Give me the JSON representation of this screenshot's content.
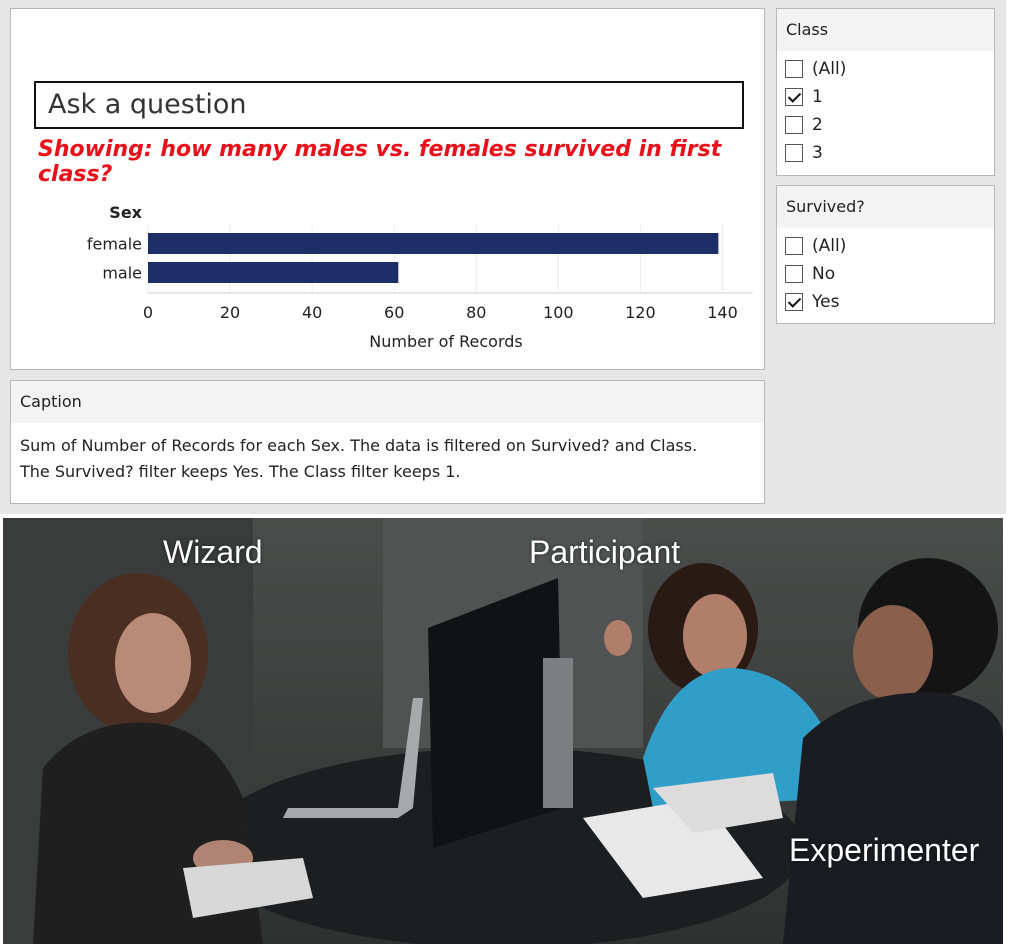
{
  "ask_placeholder": "Ask a question",
  "showing_text": "Showing: how many males vs. females survived in first class?",
  "chart_data": {
    "type": "bar",
    "orientation": "horizontal",
    "dimension_label": "Sex",
    "categories": [
      "female",
      "male"
    ],
    "values": [
      139,
      61
    ],
    "xlabel": "Number of Records",
    "xlim": [
      0,
      145
    ],
    "ticks": [
      "0",
      "20",
      "40",
      "60",
      "80",
      "100",
      "120",
      "140"
    ],
    "bar_color": "#1c2f66"
  },
  "caption": {
    "header": "Caption",
    "line1": "Sum of Number of Records for each Sex. The data is filtered on Survived? and Class.",
    "line2": "The Survived? filter keeps Yes. The Class filter keeps 1."
  },
  "filters": {
    "class": {
      "title": "Class",
      "options": [
        {
          "label": "(All)",
          "checked": false
        },
        {
          "label": "1",
          "checked": true
        },
        {
          "label": "2",
          "checked": false
        },
        {
          "label": "3",
          "checked": false
        }
      ]
    },
    "survived": {
      "title": "Survived?",
      "options": [
        {
          "label": "(All)",
          "checked": false
        },
        {
          "label": "No",
          "checked": false
        },
        {
          "label": "Yes",
          "checked": true
        }
      ]
    }
  },
  "photo_labels": {
    "wizard": "Wizard",
    "participant": "Participant",
    "experimenter": "Experimenter"
  }
}
